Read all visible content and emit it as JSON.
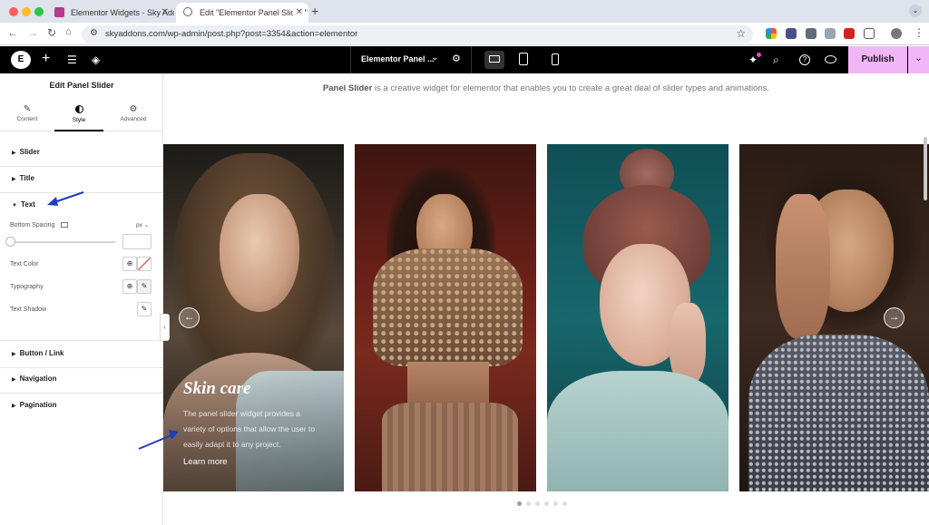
{
  "browser": {
    "tabs": [
      {
        "label": "Elementor Widgets - Sky Add"
      },
      {
        "label": "Edit \"Elementor Panel Slider \""
      }
    ],
    "url": "skyaddons.com/wp-admin/post.php?post=3354&action=elementor"
  },
  "topbar": {
    "page_name": "Elementor Panel ...",
    "publish_label": "Publish"
  },
  "panel": {
    "title": "Edit Panel Slider",
    "tabs": [
      {
        "label": "Content"
      },
      {
        "label": "Style"
      },
      {
        "label": "Advanced"
      }
    ],
    "sections": {
      "slider": "Slider",
      "title": "Title",
      "text": "Text",
      "button_link": "Button / Link",
      "navigation": "Navigation",
      "pagination": "Pagination"
    },
    "controls": {
      "bottom_spacing": "Bottom Spacing",
      "unit": "px",
      "text_color": "Text Color",
      "typography": "Typography",
      "text_shadow": "Text Shadow"
    }
  },
  "preview": {
    "intro_bold": "Panel Slider",
    "intro_rest": " is a creative widget for elementor that enables you to create a great deal of slider types and animations.",
    "slide": {
      "title": "Skin care",
      "text": "The panel slider widget provides a variety of options that allow the user to easily adapt it to any project.",
      "link": "Learn more"
    },
    "pagination_count": 6,
    "pagination_active": 1
  },
  "colors": {
    "publish_bg": "#f0b6f5",
    "annotation_arrow": "#1f3cbf"
  }
}
